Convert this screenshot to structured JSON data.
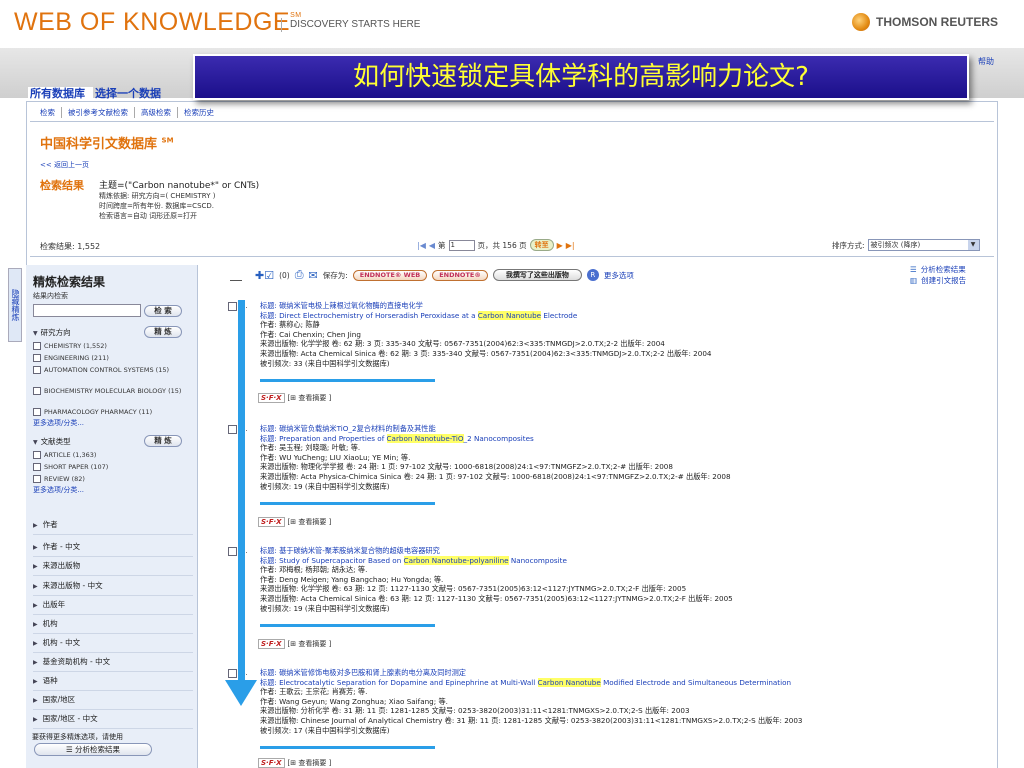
{
  "header": {
    "logo": "WEB OF KNOWLEDGE",
    "logo_mark": "SM",
    "tagline": "DISCOVERY STARTS HERE",
    "brand": "THOMSON REUTERS",
    "help": "帮助"
  },
  "question": "如何快速锁定具体学科的高影响力论文?",
  "db_tabs": [
    "所有数据库",
    "选择一个数据"
  ],
  "subtabs": [
    "检索",
    "被引参考文献检索",
    "高级检索",
    "检索历史"
  ],
  "db_title": "中国科学引文数据库",
  "db_title_mark": "SM",
  "back_link": "<< 返回上一页",
  "results": {
    "label": "检索结果",
    "topic": "主题=(\"Carbon nanotube*\" or CNTs)",
    "meta": [
      "精炼依据: 研究方向=( CHEMISTRY )",
      "时间跨度=所有年份. 数据库=CSCD.",
      "检索语言=自动 词形还原=打开"
    ]
  },
  "pager": {
    "count_label": "检索结果: 1,552",
    "page_prefix": "第",
    "page_value": "1",
    "page_suffix": "页，共 156 页",
    "go": "转至"
  },
  "sort": {
    "label": "排序方式:",
    "value": "被引频次 (降序)"
  },
  "vtab": "隐藏精炼",
  "left": {
    "title": "精炼检索结果",
    "sub": "结果内检索",
    "search_btn": "检 索",
    "refine_btn": "精 炼",
    "sec1": "研究方向",
    "sec1_items": [
      "CHEMISTRY (1,552)",
      "ENGINEERING (211)",
      "AUTOMATION CONTROL SYSTEMS (15)",
      "BIOCHEMISTRY MOLECULAR BIOLOGY (15)",
      "PHARMACOLOGY PHARMACY (11)"
    ],
    "more1": "更多选项/分类...",
    "sec2": "文献类型",
    "sec2_items": [
      "ARTICLE (1,363)",
      "SHORT PAPER (107)",
      "REVIEW (82)"
    ],
    "more2": "更多选项/分类...",
    "collapsed": [
      "作者",
      "作者 - 中文",
      "来源出版物",
      "来源出版物 - 中文",
      "出版年",
      "机构",
      "机构 - 中文",
      "基金资助机构 - 中文",
      "语种",
      "国家/地区",
      "国家/地区 - 中文"
    ],
    "bottom_text": "要获得更多精炼选项，请使用",
    "analyze_btn": "分析检索结果"
  },
  "toolbar": {
    "marked": "(0)",
    "save_as": "保存为:",
    "endnote_web": "ENDNOTE® WEB",
    "endnote": "ENDNOTE®",
    "rid": "我撰写了这些出版物",
    "r": "R",
    "more": "更多选项"
  },
  "right_links": [
    "分析检索结果",
    "创建引文报告"
  ],
  "records": [
    {
      "num": "1.",
      "title_cn": "标题: 碳纳米管电极上辣根过氧化物酶的直接电化学",
      "title_pre": "标题: Direct Electrochemistry of Horseradish Peroxidase at a ",
      "title_hl": "Carbon Nanotube",
      "title_post": " Electrode",
      "author_cn": "作者: 蔡称心; 陈静",
      "author_en": "作者: Cai Chenxin; Chen Jing",
      "src_cn": "来源出版物: 化学学报  卷: 62  期: 3  页: 335-340  文献号: 0567-7351(2004)62:3<335:TNMGDJ>2.0.TX;2-2  出版年: 2004",
      "src_en": "来源出版物: Acta Chemical Sinica  卷: 62  期: 3  页: 335-340  文献号: 0567-7351(2004)62:3<335:TNMGDJ>2.0.TX;2-2  出版年: 2004",
      "cited": "被引频次: 33 (来自中国科学引文数据库)",
      "abstract": "[⊞ 查看摘要 ]"
    },
    {
      "num": "2.",
      "title_cn": "标题: 碳纳米管负载纳米TiO_2复合材料的制备及其性能",
      "title_pre": "标题: Preparation and Properties of ",
      "title_hl": "Carbon Nanotube-TiO",
      "title_post": "_2 Nanocomposites",
      "author_cn": "作者: 吴玉程; 刘晓璐; 叶敏; 等.",
      "author_en": "作者: WU YuCheng; LIU XiaoLu; YE Min; 等.",
      "src_cn": "来源出版物: 物理化学学报  卷: 24  期: 1  页: 97-102  文献号: 1000-6818(2008)24:1<97:TNMGFZ>2.0.TX;2-#  出版年: 2008",
      "src_en": "来源出版物: Acta Physica-Chimica Sinica  卷: 24  期: 1  页: 97-102  文献号: 1000-6818(2008)24:1<97:TNMGFZ>2.0.TX;2-#  出版年: 2008",
      "cited": "被引频次: 19 (来自中国科学引文数据库)",
      "abstract": "[⊞ 查看摘要 ]"
    },
    {
      "num": "3.",
      "title_cn": "标题: 基于碳纳米管-聚苯胺纳米复合物的超级电容器研究",
      "title_pre": "标题: Study of Supercapacitor Based on ",
      "title_hl": "Carbon Nanotube-polyaniline",
      "title_post": " Nanocomposite",
      "author_cn": "作者: 邓梅根; 杨邦朝; 胡永达; 等.",
      "author_en": "作者: Deng Meigen; Yang Bangchao; Hu Yongda; 等.",
      "src_cn": "来源出版物: 化学学报  卷: 63  期: 12  页: 1127-1130  文献号: 0567-7351(2005)63:12<1127:JYTNMG>2.0.TX;2-F  出版年: 2005",
      "src_en": "来源出版物: Acta Chemical Sinica  卷: 63  期: 12  页: 1127-1130  文献号: 0567-7351(2005)63:12<1127:JYTNMG>2.0.TX;2-F  出版年: 2005",
      "cited": "被引频次: 19 (来自中国科学引文数据库)",
      "abstract": "[⊞ 查看摘要 ]"
    },
    {
      "num": "4.",
      "title_cn": "标题: 碳纳米管修饰电极对多巴胺和肾上腺素的电分离及同时测定",
      "title_pre": "标题: Electrocatalytic Separation for Dopamine and Epinephrine at Multi-Wall ",
      "title_hl": "Carbon Nanotube",
      "title_post": " Modified Electrode and Simultaneous Determination",
      "author_cn": "作者: 王歌云; 王宗花; 肖赛芳; 等.",
      "author_en": "作者: Wang Geyun; Wang Zonghua; Xiao Saifang; 等.",
      "src_cn": "来源出版物: 分析化学  卷: 31  期: 11  页: 1281-1285  文献号: 0253-3820(2003)31:11<1281:TNMGXS>2.0.TX;2-S  出版年: 2003",
      "src_en": "来源出版物: Chinese Journal of Analytical Chemistry  卷: 31  期: 11  页: 1281-1285  文献号: 0253-3820(2003)31:11<1281:TNMGXS>2.0.TX;2-S  出版年: 2003",
      "cited": "被引频次: 17 (来自中国科学引文数据库)",
      "abstract": "[⊞ 查看摘要 ]"
    }
  ]
}
